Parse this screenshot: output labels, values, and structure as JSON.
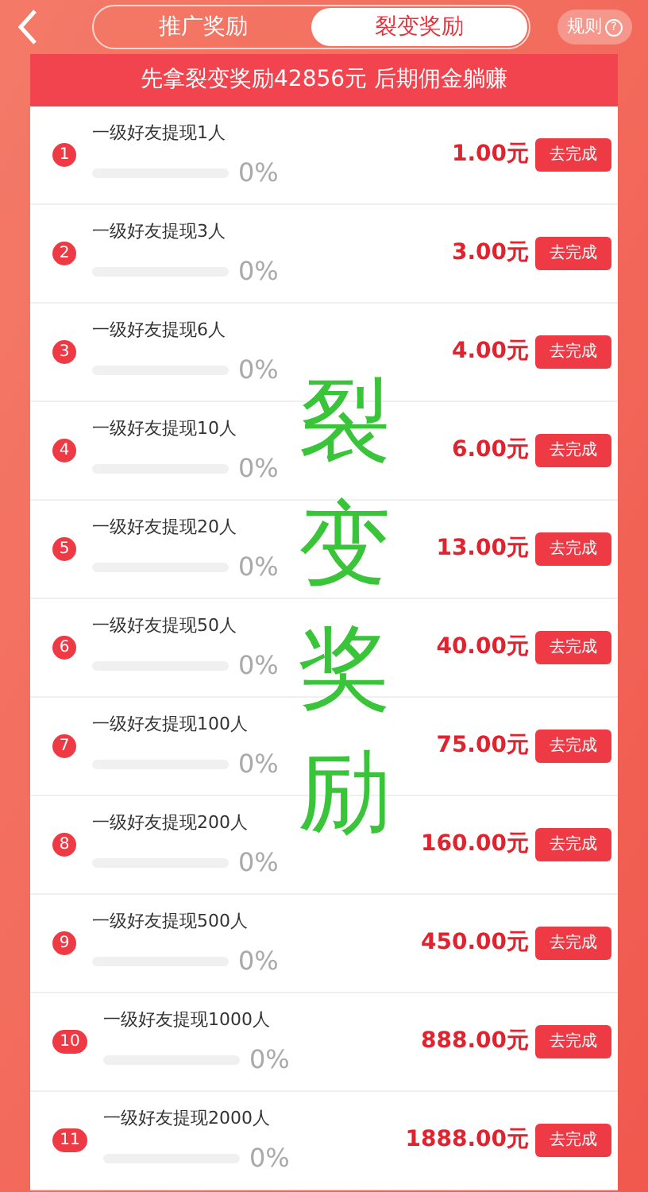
{
  "tabs": [
    {
      "label": "推广奖励",
      "selected": false
    },
    {
      "label": "裂变奖励",
      "selected": true
    }
  ],
  "rules_button": {
    "label": "规则",
    "icon": "?"
  },
  "banner": "先拿裂变奖励42856元 后期佣金躺赚",
  "tasks": [
    {
      "number": "1",
      "title": "一级好友提现1人",
      "level": 0,
      "percent": "0%",
      "reward": "1.00元",
      "action": "去完成"
    },
    {
      "number": "2",
      "title": "一级好友提现3人",
      "level": 0,
      "percent": "0%",
      "reward": "3.00元",
      "action": "去完成"
    },
    {
      "number": "3",
      "title": "一级好友提现6人",
      "level": 0,
      "percent": "0%",
      "reward": "4.00元",
      "action": "去完成"
    },
    {
      "number": "4",
      "title": "一级好友提现10人",
      "level": 0,
      "percent": "0%",
      "reward": "6.00元",
      "action": "去完成"
    },
    {
      "number": "5",
      "title": "一级好友提现20人",
      "level": 0,
      "percent": "0%",
      "reward": "13.00元",
      "action": "去完成"
    },
    {
      "number": "6",
      "title": "一级好友提现50人",
      "level": 0,
      "percent": "0%",
      "reward": "40.00元",
      "action": "去完成"
    },
    {
      "number": "7",
      "title": "一级好友提现100人",
      "level": 0,
      "percent": "0%",
      "reward": "75.00元",
      "action": "去完成"
    },
    {
      "number": "8",
      "title": "一级好友提现200人",
      "level": 0,
      "percent": "0%",
      "reward": "160.00元",
      "action": "去完成"
    },
    {
      "number": "9",
      "title": "一级好友提现500人",
      "level": 0,
      "percent": "0%",
      "reward": "450.00元",
      "action": "去完成"
    },
    {
      "number": "10",
      "title": "一级好友提现1000人",
      "level": 0,
      "percent": "0%",
      "reward": "888.00元",
      "action": "去完成"
    },
    {
      "number": "11",
      "title": "一级好友提现2000人",
      "level": 0,
      "percent": "0%",
      "reward": "1888.00元",
      "action": "去完成"
    }
  ],
  "overlay_label": "裂变奖励"
}
